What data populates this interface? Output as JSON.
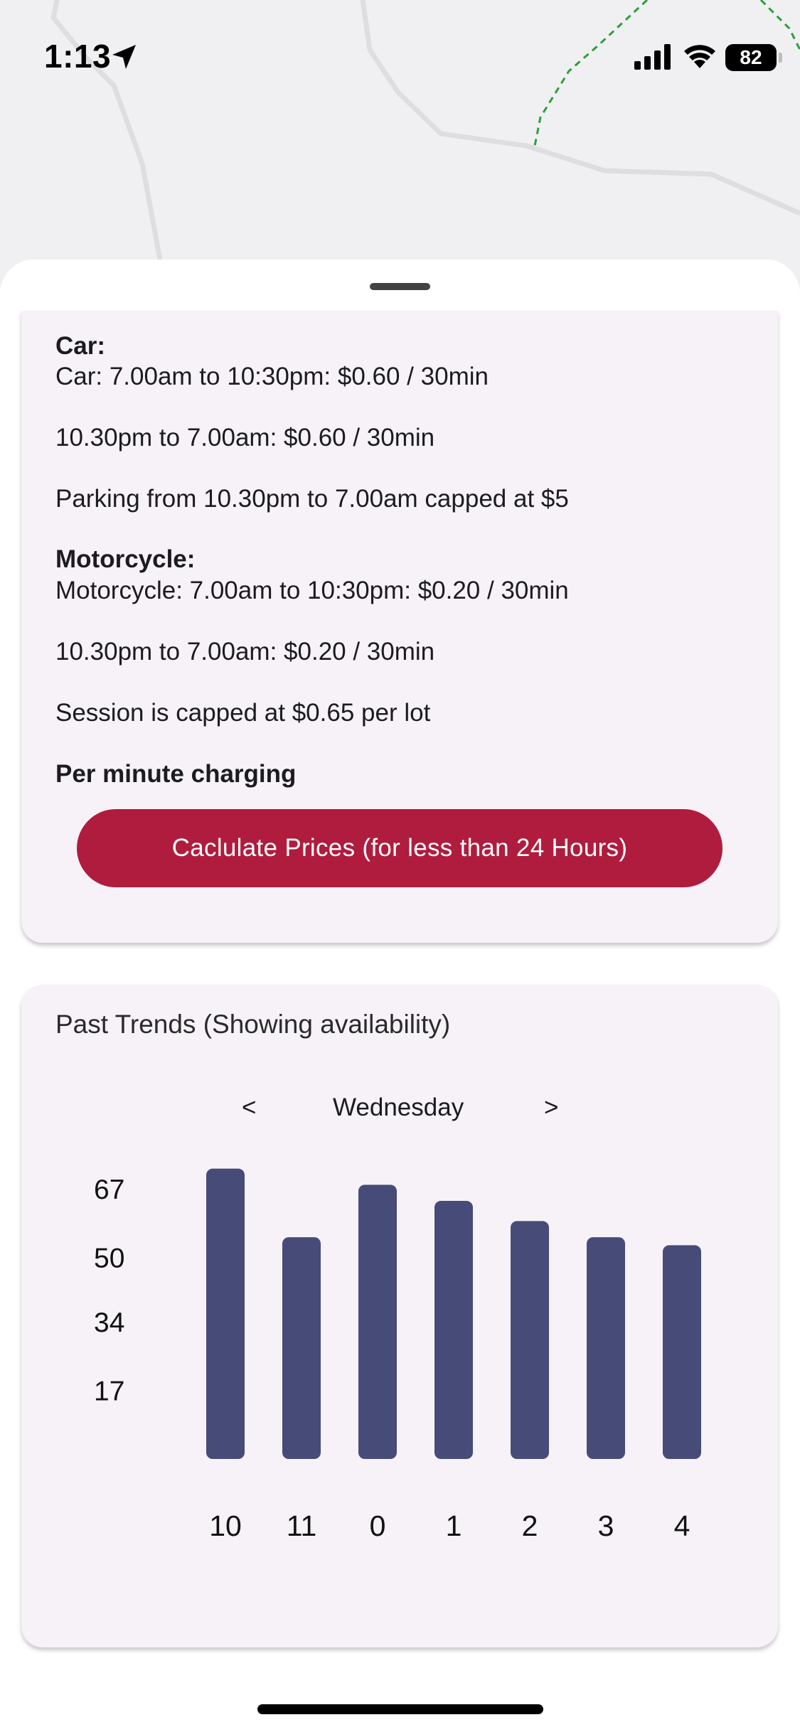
{
  "status_bar": {
    "time": "1:13",
    "battery": "82"
  },
  "pricing": {
    "car_heading": "Car:",
    "car_day": "Car: 7.00am to 10:30pm: $0.60 / 30min",
    "car_night": "10.30pm to 7.00am: $0.60 / 30min",
    "car_cap": "Parking from 10.30pm to 7.00am capped at $5",
    "moto_heading": "Motorcycle:",
    "moto_day": "Motorcycle: 7.00am to 10:30pm: $0.20 / 30min",
    "moto_night": "10.30pm to 7.00am: $0.20 / 30min",
    "moto_cap": "Session is capped at $0.65 per lot",
    "charging_note": "Per minute charging",
    "calc_button": "Caclulate Prices (for less than 24 Hours)"
  },
  "trends": {
    "title": "Past Trends (Showing availability)",
    "prev_label": "<",
    "day": "Wednesday",
    "next_label": ">"
  },
  "colors": {
    "bar": "#474b78",
    "button": "#b01c3e",
    "route": "#2e9e3a"
  },
  "chart_data": {
    "type": "bar",
    "categories": [
      "10",
      "11",
      "0",
      "1",
      "2",
      "3",
      "4"
    ],
    "values": [
      72,
      55,
      68,
      64,
      59,
      55,
      53
    ],
    "ylim": [
      0,
      73
    ],
    "yticks": [
      "17",
      "34",
      "50",
      "67"
    ],
    "ytick_values": [
      17,
      34,
      50,
      67
    ],
    "title": "",
    "xlabel": "",
    "ylabel": "",
    "grid": false
  }
}
